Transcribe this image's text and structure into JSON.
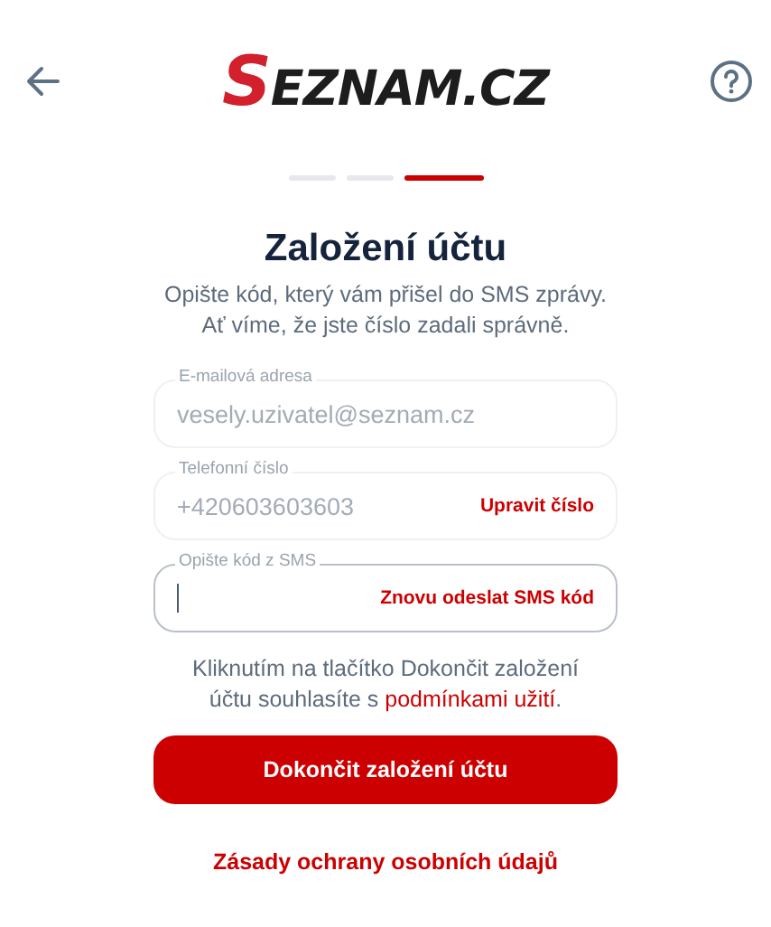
{
  "header": {
    "logo": {
      "initial": "S",
      "rest": "EZNAM.CZ"
    }
  },
  "steps": [
    {
      "active": false
    },
    {
      "active": false
    },
    {
      "active": true
    }
  ],
  "title": "Založení účtu",
  "subtitle": [
    "Opište kód, který vám přišel do SMS zprávy.",
    "Ať víme, že jste číslo zadali správně."
  ],
  "fields": [
    {
      "label": "E-mailová adresa",
      "value": "vesely.uzivatel@seznam.cz",
      "focused": false
    },
    {
      "label": "Telefonní číslo",
      "value": "+420603603603",
      "action": "Upravit číslo",
      "focused": false
    },
    {
      "label": "Opište kód z SMS",
      "action": "Znovu odeslat SMS kód",
      "focused": true
    }
  ],
  "terms": {
    "text": "Kliknutím na tlačítko Dokončit založení účtu souhlasíte s",
    "link": "podmínkami užití",
    "end": "."
  },
  "submit": "Dokončit založení účtu",
  "privacy_link": "Zásady ochrany osobních údajů"
}
